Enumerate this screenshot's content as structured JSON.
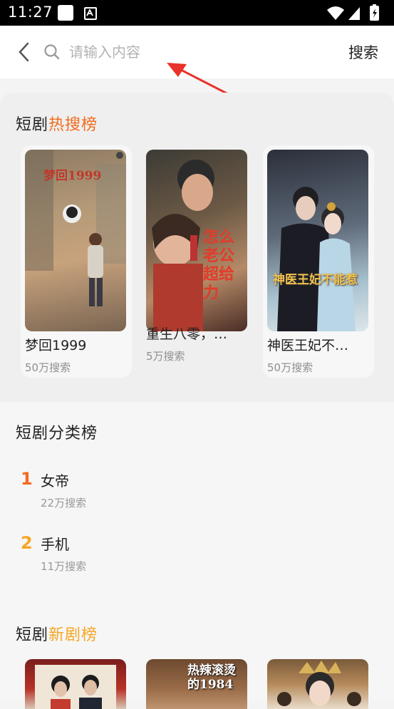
{
  "status_bar": {
    "time": "11:27"
  },
  "search": {
    "placeholder": "请输入内容",
    "button_label": "搜索"
  },
  "hot_section": {
    "title_prefix": "短剧",
    "title_highlight": "热搜榜",
    "items": [
      {
        "title": "梦回1999",
        "count": "50万搜索",
        "poster_text": "梦回1999"
      },
      {
        "title": "重生八零，…",
        "count": "5万搜索",
        "poster_text": "怎么老公超给力"
      },
      {
        "title": "神医王妃不…",
        "count": "50万搜索",
        "poster_text": "神医王妃不能惹"
      }
    ]
  },
  "category_section": {
    "title": "短剧分类榜",
    "items": [
      {
        "rank": "1",
        "name": "女帝",
        "count": "22万搜索"
      },
      {
        "rank": "2",
        "name": "手机",
        "count": "11万搜索"
      }
    ]
  },
  "new_section": {
    "title_prefix": "短剧",
    "title_highlight": "新剧榜",
    "poster_text": "热辣滚烫的1984"
  },
  "colors": {
    "accent_orange": "#f26b1d",
    "accent_yellow": "#f5a623",
    "annotation_red": "#e8322b"
  }
}
